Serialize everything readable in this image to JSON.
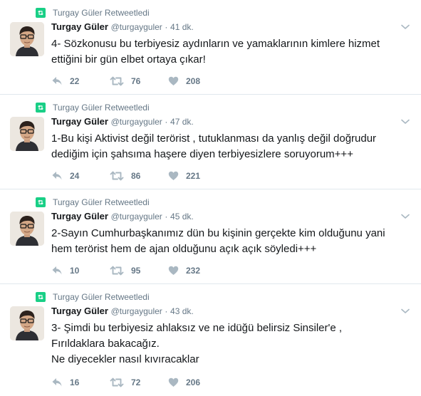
{
  "tweets": [
    {
      "retweet_label": "Turgay Güler Retweetledi",
      "name": "Turgay Güler",
      "handle": "@turgayguler",
      "time": "41 dk.",
      "text": "4- Sözkonusu bu terbiyesiz aydınların ve yamaklarının kimlere hizmet ettiğini bir gün elbet ortaya çıkar!",
      "replies": "22",
      "retweets": "76",
      "likes": "208"
    },
    {
      "retweet_label": "Turgay Güler Retweetledi",
      "name": "Turgay Güler",
      "handle": "@turgayguler",
      "time": "47 dk.",
      "text": "1-Bu kişi Aktivist değil terörist , tutuklanması da yanlış değil doğrudur dediğim için şahsıma haşere diyen terbiyesizlere soruyorum+++",
      "replies": "24",
      "retweets": "86",
      "likes": "221"
    },
    {
      "retweet_label": "Turgay Güler Retweetledi",
      "name": "Turgay Güler",
      "handle": "@turgayguler",
      "time": "45 dk.",
      "text": "2-Sayın Cumhurbaşkanımız dün bu kişinin gerçekte kim olduğunu yani hem terörist hem de ajan olduğunu açık açık söyledi+++",
      "replies": "10",
      "retweets": "95",
      "likes": "232"
    },
    {
      "retweet_label": "Turgay Güler Retweetledi",
      "name": "Turgay Güler",
      "handle": "@turgayguler",
      "time": "43 dk.",
      "text": "3- Şimdi bu terbiyesiz ahlaksız ve ne idüğü belirsiz Sinsiler'e ,\nFırıldaklara bakacağız.\nNe diyecekler nasıl kıvıracaklar",
      "replies": "16",
      "retweets": "72",
      "likes": "206"
    }
  ],
  "icons": {
    "retweet_badge": "retweet-badge-icon",
    "caret": "chevron-down-icon",
    "reply": "reply-icon",
    "retweet": "retweet-icon",
    "like": "heart-icon"
  },
  "colors": {
    "retweet_green": "#19cf86",
    "muted": "#657786",
    "action_icon": "#aab8c2",
    "divider": "#e1e8ed"
  },
  "separator": "·"
}
